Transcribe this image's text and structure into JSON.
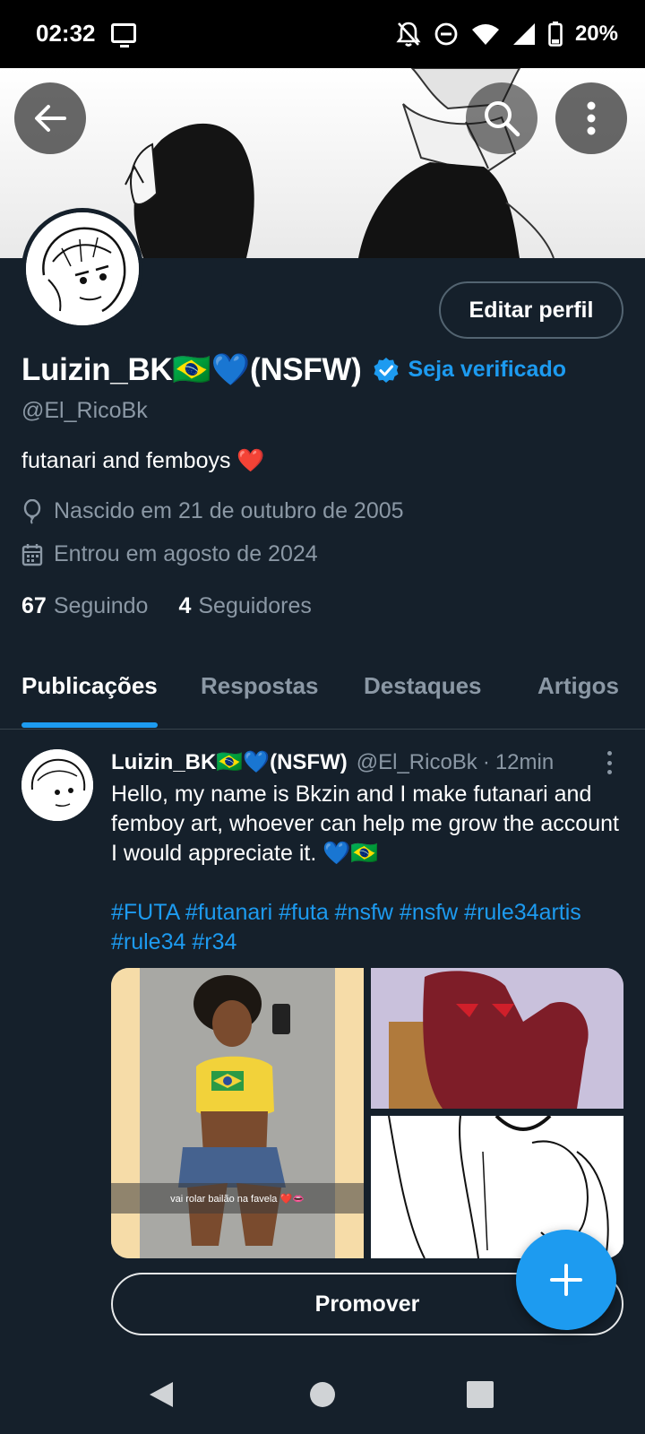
{
  "status_bar": {
    "time": "02:32",
    "battery": "20%"
  },
  "profile": {
    "edit_label": "Editar perfil",
    "name": "Luizin_BK🇧🇷💙(NSFW)",
    "get_verified": "Seja verificado",
    "handle": "@El_RicoBk",
    "bio": "futanari and femboys ❤️",
    "birth": "Nascido em 21 de outubro de 2005",
    "joined": "Entrou em agosto de 2024",
    "following_count": "67",
    "following_label": "Seguindo",
    "followers_count": "4",
    "followers_label": "Seguidores"
  },
  "tabs": [
    {
      "label": "Publicações",
      "active": true
    },
    {
      "label": "Respostas",
      "active": false
    },
    {
      "label": "Destaques",
      "active": false
    },
    {
      "label": "Artigos",
      "active": false
    }
  ],
  "post": {
    "name": "Luizin_BK🇧🇷💙(NSFW)",
    "handle": "@El_RicoBk",
    "separator": "·",
    "time": "12min",
    "text": "Hello, my name is Bkzin and I make futanari and femboy art, whoever can help me grow the account I would appreciate it. 💙🇧🇷",
    "hashtags": "#FUTA #futanari #futa #nsfw #nsfw #rule34artis #rule34 #r34",
    "media_caption": "vai rolar bailão na favela ❤️👄",
    "promote_label": "Promover"
  },
  "colors": {
    "accent": "#1d9bf0",
    "background": "#15202b",
    "muted": "#8b98a5"
  },
  "icons": [
    "back-arrow-icon",
    "search-icon",
    "more-vertical-icon",
    "verified-badge-icon",
    "balloon-icon",
    "calendar-icon",
    "compose-plus-icon",
    "nav-back-icon",
    "nav-home-icon",
    "nav-recents-icon"
  ]
}
